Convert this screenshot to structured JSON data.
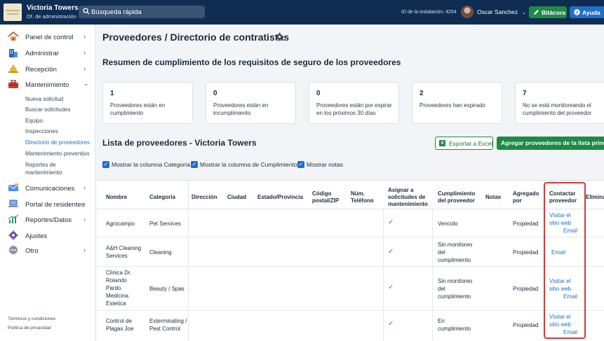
{
  "header": {
    "brand_name": "Victoria Towers",
    "brand_sub": "Of. de administración",
    "search_placeholder": "Búsqueda rápida",
    "install_id": "ID de la instalación: 4254",
    "user_name": "Oscar Sanchez",
    "bitacora_label": "Bitácora",
    "ayuda_label": "Ayuda"
  },
  "sidebar": {
    "items": [
      {
        "label": "Panel de control",
        "icon": "home-icon"
      },
      {
        "label": "Administrar",
        "icon": "building-icon"
      },
      {
        "label": "Recepción",
        "icon": "bell-icon"
      },
      {
        "label": "Mantenimiento",
        "icon": "toolbox-icon"
      },
      {
        "label": "Comunicaciones",
        "icon": "mail-icon"
      },
      {
        "label": "Portal de residentes",
        "icon": "laptop-icon"
      },
      {
        "label": "Reportes/Datos",
        "icon": "chart-icon"
      },
      {
        "label": "Ajustes",
        "icon": "gear-icon"
      },
      {
        "label": "Otro",
        "icon": "more-icon"
      }
    ],
    "maintenance_sub": [
      "Nueva solicitud",
      "Buscar solicitudes",
      "Equipo",
      "Inspecciones",
      "Directorio de proveedores",
      "Mantenimiento preventivo",
      "Reportes de",
      "mantenimiento"
    ],
    "terms": "Términos y condiciones",
    "privacy": "Política de privacidad"
  },
  "main": {
    "title": "Proveedores / Directorio de contratistas",
    "summary_title": "Resumen de cumplimiento de los requisitos de seguro de los proveedores",
    "cards": [
      {
        "num": "1",
        "text": "Proveedores están en cumplimiento"
      },
      {
        "num": "0",
        "text": "Proveedores están en incumplimiento"
      },
      {
        "num": "0",
        "text": "Proveedores están por expirar en los próximos 30 días"
      },
      {
        "num": "2",
        "text": "Proveedores han expirado"
      },
      {
        "num": "7",
        "text": "No se está monitoreando el cumplimiento del proveedor"
      }
    ],
    "list_title": "Lista de proveedores - Victoria Towers",
    "export_label": "Exportar a Excel",
    "add_label": "Agregar proveedores de la lista principal",
    "checkboxes": [
      "Mostrar la columna Categoría",
      "Mostrar la columna de Cumplimiento",
      "Mostrar notas"
    ]
  },
  "table": {
    "headers": {
      "nombre": "Nombre",
      "categoria": "Categoría",
      "direccion": "Dirección",
      "ciudad": "Ciudad",
      "estado": "Estado/Provincia",
      "codigo": "Código postal/ZIP",
      "telefono": "Núm. Teléfono",
      "asignar": "Asignar a solicitudes de mantenimiento",
      "cumplimiento": "Cumplimiento del proveedor",
      "notas": "Notas",
      "agregado": "Agregado por",
      "contactar": "Contactar proveedor",
      "eliminar": "Elimina"
    },
    "rows": [
      {
        "nombre": "Agrocampo",
        "categoria": "Pet Services",
        "cumplimiento": "Vencido",
        "agregado": "Propiedad",
        "visitar": "Visitar el sitio web",
        "email": "Email"
      },
      {
        "nombre": "A&H Cleaning Services",
        "categoria": "Cleaning",
        "cumplimiento": "Sin monitoreo del cumplimiento",
        "agregado": "Propiedad",
        "visitar": "",
        "email": "Email"
      },
      {
        "nombre": "Clinica Dr. Rolando Pardo. Medicina Estetica",
        "categoria": "Beauty / Spas",
        "cumplimiento": "Sin monitoreo del cumplimiento",
        "agregado": "Propiedad",
        "visitar": "Visitar el sitio web",
        "email": "Email"
      },
      {
        "nombre": "Control de Plagas Joe",
        "categoria": "Exterminating / Pest Control",
        "cumplimiento": "En cumplimiento",
        "agregado": "Propiedad",
        "visitar": "Visitar el sitio web",
        "email": "Email"
      }
    ],
    "check_mark": "✓"
  },
  "colors": {
    "topbar": "#0f2d52",
    "accent_green": "#1e8a45",
    "accent_blue": "#1f6fc8",
    "highlight_red": "#d43a3a"
  }
}
